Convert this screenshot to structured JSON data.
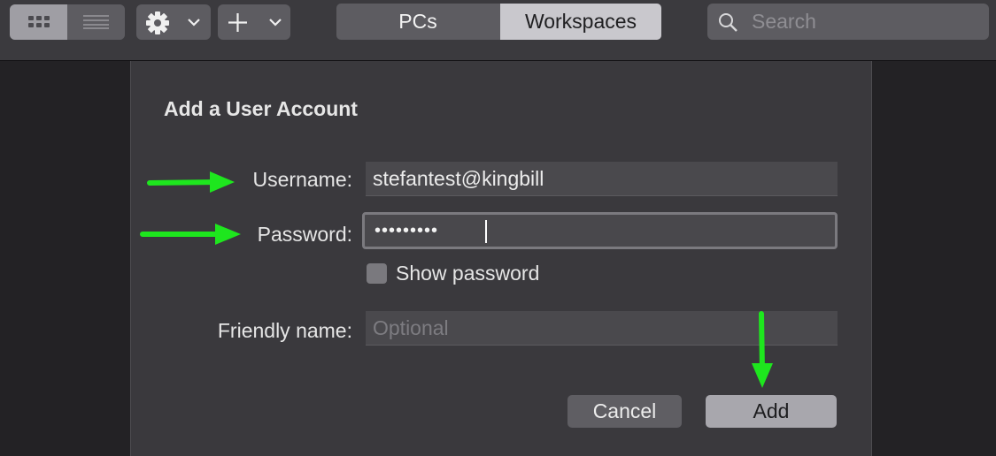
{
  "toolbar": {
    "view_toggle": {
      "grid_icon": "grid-icon",
      "list_icon": "list-icon"
    },
    "settings_menu_icon": "gear-icon",
    "add_menu_icon": "plus-icon",
    "tabs": [
      {
        "label": "PCs",
        "selected": false
      },
      {
        "label": "Workspaces",
        "selected": true
      }
    ],
    "search": {
      "placeholder": "Search",
      "icon": "search-icon"
    }
  },
  "dialog": {
    "title": "Add a User Account",
    "username": {
      "label": "Username:",
      "value": "stefantest@kingbill"
    },
    "password": {
      "label": "Password:",
      "masked_value": "•••••••••"
    },
    "show_password": {
      "label": "Show password",
      "checked": false
    },
    "friendly_name": {
      "label": "Friendly name:",
      "placeholder": "Optional",
      "value": ""
    },
    "buttons": {
      "cancel": "Cancel",
      "add": "Add"
    }
  },
  "annotations": {
    "arrow_color": "#1ee61e",
    "arrows": [
      "arrow-to-username",
      "arrow-to-password",
      "arrow-to-add-button"
    ]
  }
}
